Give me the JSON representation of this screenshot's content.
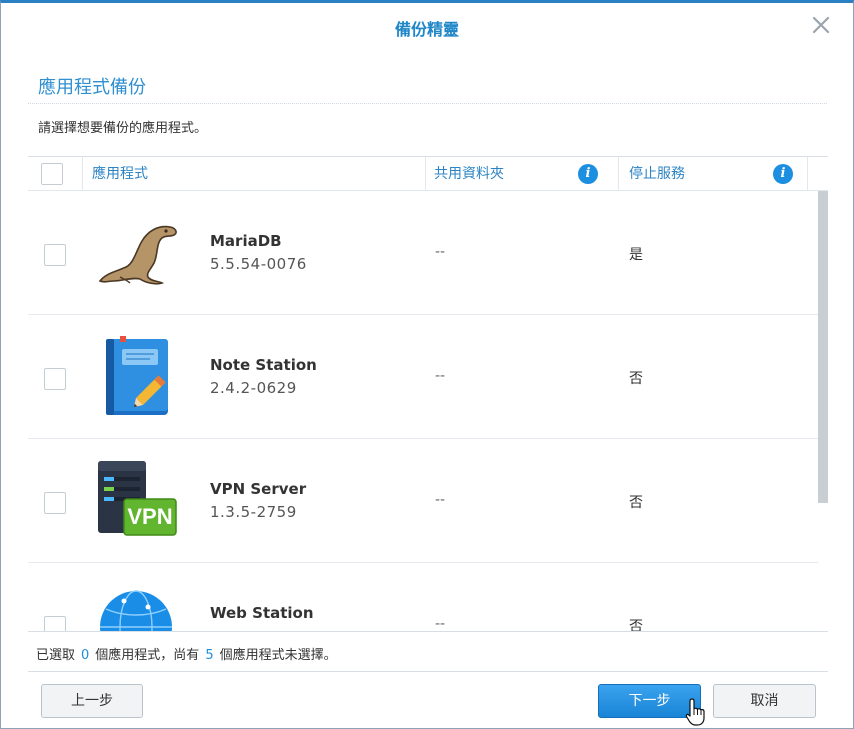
{
  "window": {
    "title": "備份精靈",
    "accent_color": "#2b7fc3",
    "close_icon": "close-icon"
  },
  "section": {
    "title": "應用程式備份",
    "instruction": "請選擇想要備份的應用程式。"
  },
  "grid": {
    "columns": {
      "app": "應用程式",
      "shared_folder": "共用資料夾",
      "stop_service": "停止服務"
    },
    "info_icon": "i",
    "rows": [
      {
        "name": "MariaDB",
        "version": "5.5.54-0076",
        "shared_folder": "--",
        "stop_service": "是",
        "icon": "mariadb-seal-icon",
        "checked": false
      },
      {
        "name": "Note Station",
        "version": "2.4.2-0629",
        "shared_folder": "--",
        "stop_service": "否",
        "icon": "note-station-icon",
        "checked": false
      },
      {
        "name": "VPN Server",
        "version": "1.3.5-2759",
        "shared_folder": "--",
        "stop_service": "否",
        "icon": "vpn-server-icon",
        "checked": false
      },
      {
        "name": "Web Station",
        "version": "",
        "shared_folder": "--",
        "stop_service": "否",
        "icon": "web-station-globe-icon",
        "checked": false
      }
    ],
    "vpn_badge": "VPN"
  },
  "status": {
    "prefix": "已選取",
    "selected_count": "0",
    "middle": "個應用程式，尚有",
    "unselected_count": "5",
    "suffix": "個應用程式未選擇。"
  },
  "buttons": {
    "prev": "上一步",
    "next": "下一步",
    "cancel": "取消"
  }
}
